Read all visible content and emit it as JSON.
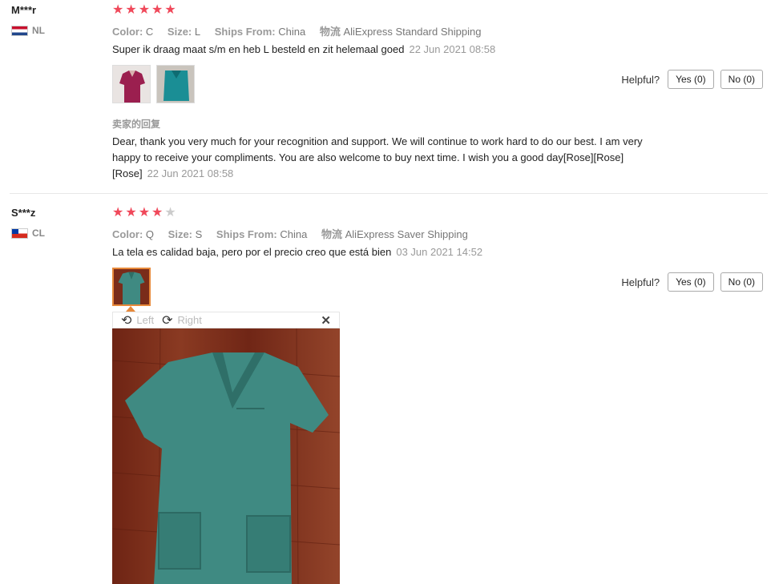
{
  "reviews": [
    {
      "user": "M***r",
      "country": "NL",
      "rating": 5,
      "meta": {
        "color_label": "Color:",
        "color": "C",
        "size_label": "Size:",
        "size": "L",
        "ships_label": "Ships From:",
        "ships": "China",
        "logistics_label": "物流",
        "logistics": "AliExpress Standard Shipping"
      },
      "text": "Super ik draag maat s/m en heb L besteld en zit helemaal goed",
      "date": "22 Jun 2021 08:58",
      "helpful_label": "Helpful?",
      "yes_label": "Yes (0)",
      "no_label": "No (0)",
      "reply_title": "卖家的回复",
      "reply_text": "Dear, thank you very much for your recognition and support. We will continue to work hard to do our best. I am very happy to receive your compliments. You are also welcome to buy next time. I wish you a good day[Rose][Rose][Rose]",
      "reply_date": "22 Jun 2021 08:58"
    },
    {
      "user": "S***z",
      "country": "CL",
      "rating": 4,
      "meta": {
        "color_label": "Color:",
        "color": "Q",
        "size_label": "Size:",
        "size": "S",
        "ships_label": "Ships From:",
        "ships": "China",
        "logistics_label": "物流",
        "logistics": "AliExpress Saver Shipping"
      },
      "text": "La tela es calidad baja, pero por el precio creo que está bien",
      "date": "03 Jun 2021 14:52",
      "helpful_label": "Helpful?",
      "yes_label": "Yes (0)",
      "no_label": "No (0)"
    }
  ],
  "viewer": {
    "rotate_left_icon": "rotate-left-icon",
    "left_label": "Left",
    "rotate_right_icon": "rotate-right-icon",
    "right_label": "Right",
    "close_icon": "close-icon"
  },
  "colors": {
    "star_on": "#f0485a",
    "star_off": "#cccccc",
    "active_thumb": "#e7893a",
    "scrub_green": "#3f8a82",
    "wood": "#7a2c1a"
  }
}
